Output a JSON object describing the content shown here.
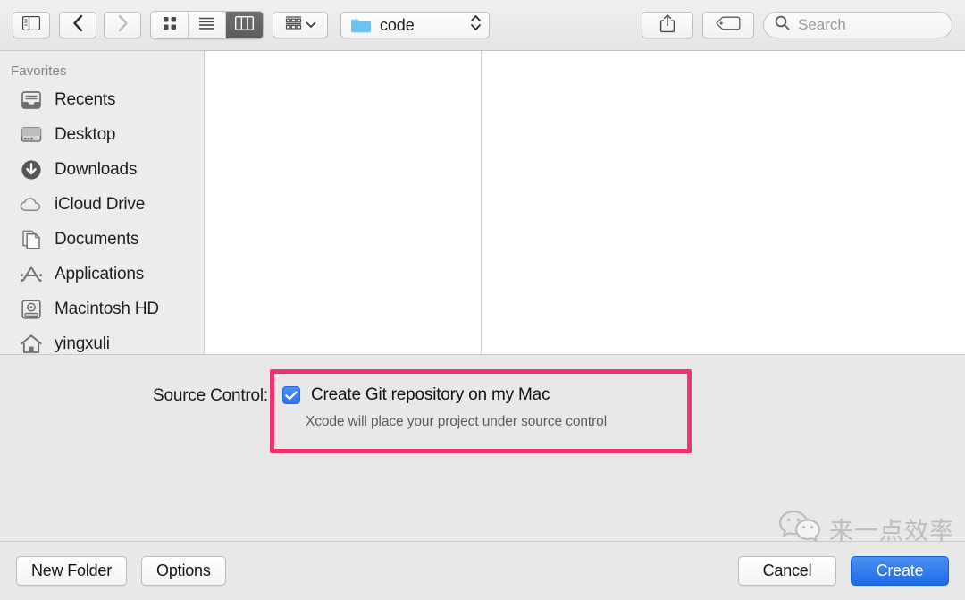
{
  "toolbar": {
    "sidebar_toggle": "sidebar-toggle",
    "back": "back",
    "forward": "forward",
    "view_icon": "icon-view",
    "view_list": "list-view",
    "view_column": "column-view",
    "arrange": "arrange",
    "path_label": "code",
    "share": "share",
    "tags": "tags",
    "search_placeholder": "Search"
  },
  "sidebar": {
    "header": "Favorites",
    "items": [
      {
        "label": "Recents",
        "icon": "recents-icon"
      },
      {
        "label": "Desktop",
        "icon": "desktop-icon"
      },
      {
        "label": "Downloads",
        "icon": "downloads-icon"
      },
      {
        "label": "iCloud Drive",
        "icon": "icloud-icon"
      },
      {
        "label": "Documents",
        "icon": "documents-icon"
      },
      {
        "label": "Applications",
        "icon": "applications-icon"
      },
      {
        "label": "Macintosh HD",
        "icon": "harddisk-icon"
      },
      {
        "label": "yingxuli",
        "icon": "home-icon"
      }
    ]
  },
  "accessory": {
    "source_control_label": "Source Control:",
    "checkbox_label": "Create Git repository on my Mac",
    "checkbox_checked": true,
    "help_text": "Xcode will place your project under source control",
    "highlight_color": "#f4326d",
    "checkbox_color": "#3478f6"
  },
  "footer": {
    "new_folder": "New Folder",
    "options": "Options",
    "cancel": "Cancel",
    "create": "Create"
  },
  "watermark": {
    "text": "来一点效率",
    "logo": "wechat-icon"
  }
}
